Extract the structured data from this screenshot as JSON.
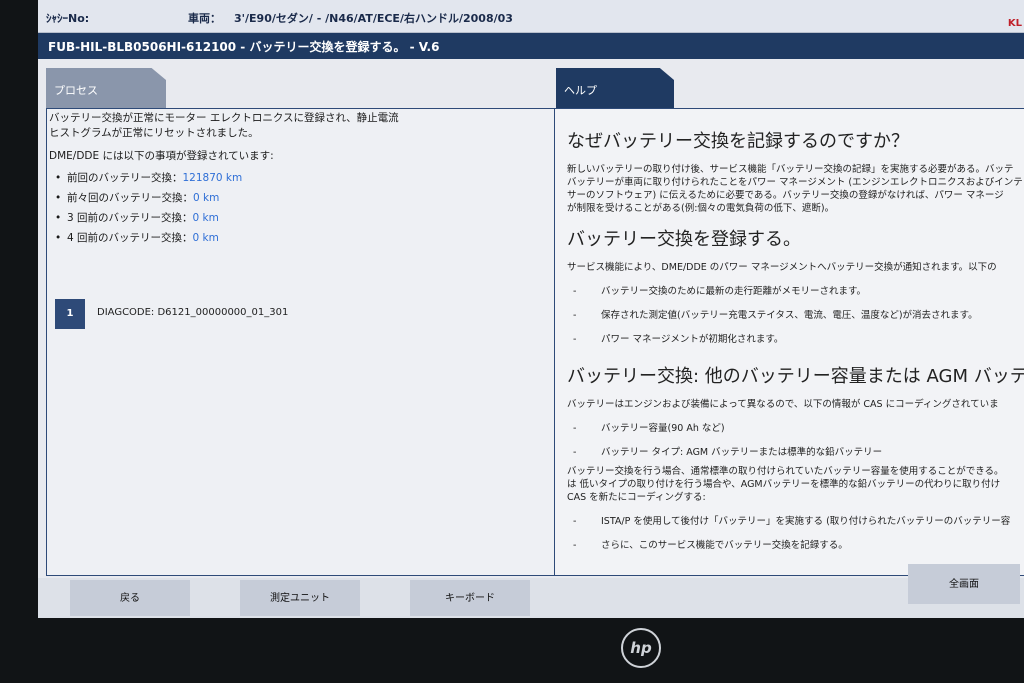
{
  "header": {
    "chassis_label": "ｼｬｼｰNo:",
    "vehicle_label": "車両：",
    "vehicle_value": "3'/E90/セダン/ - /N46/AT/ECE/右ハンドル/2008/03",
    "brand_partial": "KL"
  },
  "window_title": "FUB-HIL-BLB0506HI-612100 - バッテリー交換を登録する。 - V.6",
  "tabs": {
    "process": "プロセス",
    "help": "ヘルプ"
  },
  "process": {
    "message_line1": "バッテリー交換が正常にモーター エレクトロニクスに登録され、静止電流",
    "message_line2": "ヒストグラムが正常にリセットされました。",
    "subheading": "DME/DDE には以下の事項が登録されています:",
    "history": [
      {
        "label": "前回のバッテリー交換：",
        "value": "121870 km"
      },
      {
        "label": "前々回のバッテリー交換：",
        "value": "0 km"
      },
      {
        "label": "3 回前のバッテリー交換：",
        "value": "0 km"
      },
      {
        "label": "4 回前のバッテリー交換：",
        "value": "0 km"
      }
    ],
    "diag_index": "1",
    "diag_code": "DIAGCODE: D6121_00000000_01_301"
  },
  "help": {
    "h1": "なぜバッテリー交換を記録するのですか？",
    "p1_lines": [
      "新しいバッテリーの取り付け後、サービス機能「バッテリー交換の記録」を実施する必要がある。バッテ",
      "バッテリーが車両に取り付けられたことをパワー マネージメント (エンジンエレクトロニクスおよびインテ",
      "サーのソフトウェア) に伝えるために必要である。バッテリー交換の登録がなければ、パワー マネージ",
      "が制限を受けることがある(例:個々の電気負荷の低下、遮断)。"
    ],
    "h2": "バッテリー交換を登録する。",
    "p2": "サービス機能により、DME/DDE のパワー マネージメントへバッテリー交換が通知されます。以下の",
    "list2": [
      "バッテリー交換のために最新の走行距離がメモリーされます。",
      "保存された測定値(バッテリー充電ステイタス、電流、電圧、温度など)が消去されます。",
      "パワー マネージメントが初期化されます。"
    ],
    "h3": "バッテリー交換: 他のバッテリー容量または AGM バッテリー",
    "p3": "バッテリーはエンジンおよび装備によって異なるので、以下の情報が CAS にコーディングされていま",
    "list3": [
      "バッテリー容量(90 Ah など)",
      "バッテリー タイプ: AGM バッテリーまたは標準的な鉛バッテリー"
    ],
    "p4_lines": [
      "バッテリー交換を行う場合、通常標準の取り付けられていたバッテリー容量を使用することができる。",
      "は 低いタイプの取り付けを行う場合や、AGMバッテリーを標準的な鉛バッテリーの代わりに取り付け",
      "CAS を新たにコーディングする:"
    ],
    "list4": [
      "ISTA/P を使用して後付け「バッテリー」を実施する (取り付けられたバッテリーのバッテリー容",
      "さらに、このサービス機能でバッテリー交換を記録する。"
    ]
  },
  "buttons": {
    "back": "戻る",
    "measure_unit": "測定ユニット",
    "keyboard": "キーボード",
    "fullscreen": "全画面"
  },
  "bezel_logo": "hp"
}
